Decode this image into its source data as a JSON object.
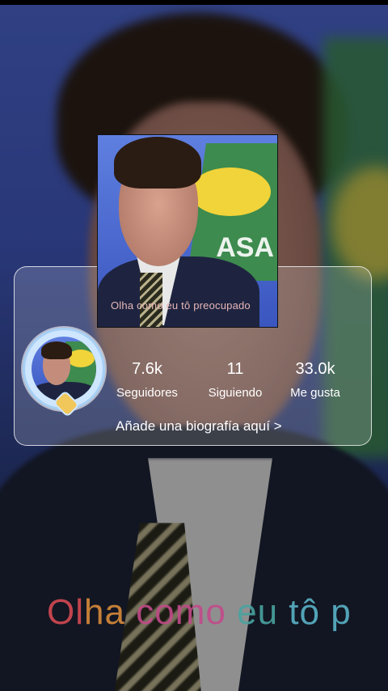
{
  "video": {
    "caption_overlay": "Olha como eu tô p",
    "thumbnail_caption": "Olha como eu tô preocupado",
    "thumbnail_flag_text": "ASA"
  },
  "profile": {
    "stats": [
      {
        "value": "7.6k",
        "label": "Seguidores"
      },
      {
        "value": "11",
        "label": "Siguiendo"
      },
      {
        "value": "33.0k",
        "label": "Me gusta"
      }
    ],
    "bio_prompt": "Añade una biografía aquí >"
  },
  "colors": {
    "accent_ring": "#a7d0f5",
    "card_border": "#ffffff"
  },
  "icons": {
    "avatar_badge": "diamond-badge-icon"
  }
}
